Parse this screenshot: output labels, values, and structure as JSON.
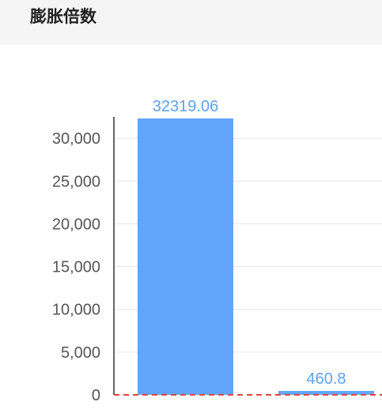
{
  "header": {
    "title": "膨胀倍数"
  },
  "chart_data": {
    "type": "bar",
    "title": "膨胀倍数",
    "xlabel": "",
    "ylabel": "",
    "categories": [
      "",
      ""
    ],
    "values": [
      32319.06,
      460.8
    ],
    "data_labels": [
      "32319.06",
      "460.8"
    ],
    "ylim": [
      0,
      32319.06
    ],
    "yticks": [
      0,
      5000,
      10000,
      15000,
      20000,
      25000,
      30000
    ],
    "ytick_labels": [
      "0",
      "5,000",
      "10,000",
      "15,000",
      "20,000",
      "25,000",
      "30,000"
    ],
    "grid": true,
    "legend": "none",
    "colors": {
      "bar": "#62a5fb",
      "data_label": "#5ea1f5",
      "axis": "#333333",
      "grid": "#e6e6e6",
      "baseline_dash": "#e0483c"
    }
  }
}
